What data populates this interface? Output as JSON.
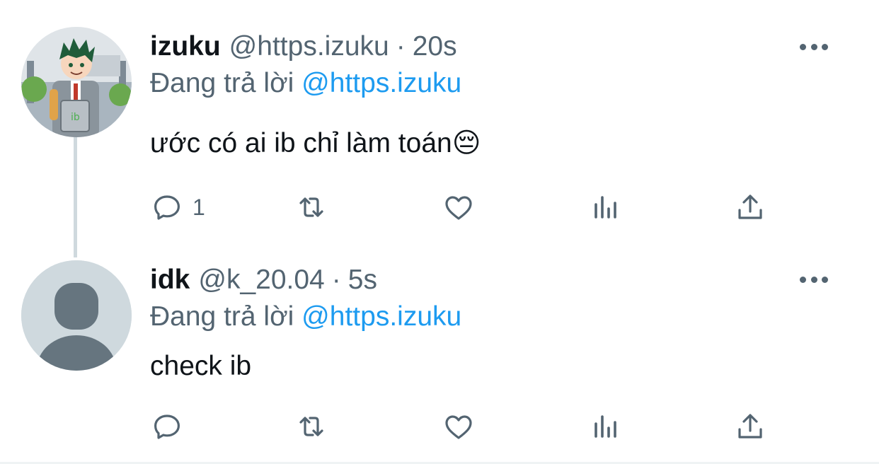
{
  "thread": {
    "tweets": [
      {
        "name": "izuku",
        "handle": "@https.izuku",
        "separator": "·",
        "time": "20s",
        "reply_prefix": "Đang trả lời",
        "reply_mention": "@https.izuku",
        "text": "ước có ai ib chỉ làm toán😔",
        "reply_count": "1",
        "avatar": "anime-character-avatar"
      },
      {
        "name": "idk",
        "handle": "@k_20.04",
        "separator": "·",
        "time": "5s",
        "reply_prefix": "Đang trả lời",
        "reply_mention": "@https.izuku",
        "text": "check ib",
        "reply_count": "",
        "avatar": "default-profile-avatar"
      }
    ]
  },
  "icons": [
    "reply-icon",
    "retweet-icon",
    "like-icon",
    "stats-icon",
    "share-icon",
    "more-icon"
  ],
  "colors": {
    "accent": "#1d9bf0",
    "secondary_text": "#536471",
    "primary_text": "#0f1419",
    "thread_line": "#cfd9de"
  }
}
